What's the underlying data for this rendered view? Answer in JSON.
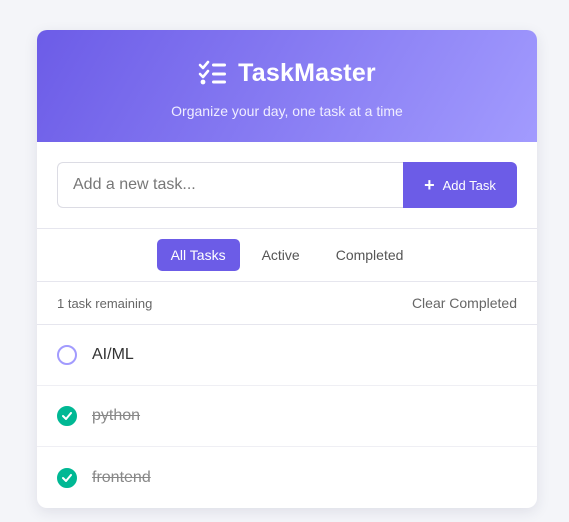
{
  "header": {
    "title": "TaskMaster",
    "subtitle": "Organize your day, one task at a time",
    "icon": "tasks-icon"
  },
  "input": {
    "placeholder": "Add a new task...",
    "value": "",
    "add_label": "Add Task"
  },
  "filters": [
    {
      "label": "All Tasks",
      "active": true
    },
    {
      "label": "Active",
      "active": false
    },
    {
      "label": "Completed",
      "active": false
    }
  ],
  "stats": {
    "remaining": "1 task remaining",
    "clear_label": "Clear Completed"
  },
  "tasks": [
    {
      "text": "AI/ML",
      "done": false
    },
    {
      "text": "python",
      "done": true
    },
    {
      "text": "frontend",
      "done": true
    }
  ],
  "colors": {
    "accent": "#6c5ce7",
    "accent_light": "#a29bfe",
    "done": "#00b894"
  }
}
